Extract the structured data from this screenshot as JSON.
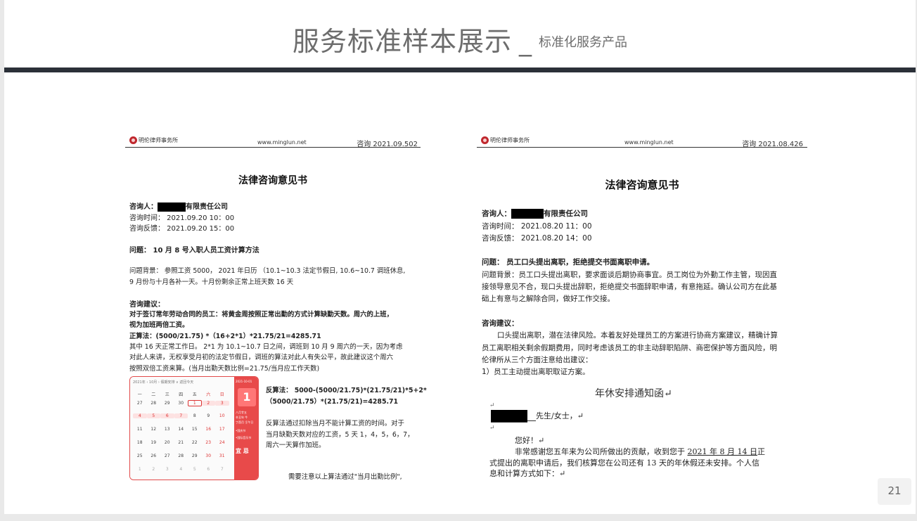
{
  "header": {
    "main_title": "服务标准样本展示",
    "separator": "_",
    "sub_title": "标准化服务产品"
  },
  "page_number": "21",
  "left_doc": {
    "logo_text": "明伦律师事务所",
    "url": "www.minglun.net",
    "doc_no": "咨询 2021.09.502",
    "title": "法律咨询意见书",
    "consultant_label": "咨询人：",
    "consultant_suffix": "有限责任公司",
    "time_line": "咨询时间： 2021.09.20 10：00",
    "feedback_line": "咨询反馈： 2021.09.20 15：00",
    "question": "问题： 10 月 8 号入职人员工资计算方法",
    "background_1": "问题背景： 参照工资 5000， 2021 年日历 （10.1~10.3 法定节假日, 10.6~10.7 调班休息,",
    "background_2": "9 月份与十月各补一天。十月份剩余正常上班天数 16 天",
    "advice_label": "咨询建议：",
    "advice_1": "对于签订常年劳动合同的员工：将黄金周按照正常出勤的方式计算缺勤天数。周六的上班，",
    "advice_2": "视为加班两倍工资。",
    "formula_1": "正算法：(5000/21.75) *（16+2*1）*21.75/21=4285.71",
    "explain_1": "其中 16 天正常工作日。 2*1 为 10.1~10.7 日之间，调班到 10 月 9 周六的一天，因为考虑",
    "explain_2": "对此人来讲，无权享受月初的法定节假日，调班的算法对此人有失公平，故此建议这个周六",
    "explain_3": "按照双倍工资来算。(当月出勤天数比例=21.75/当月应工作天数)",
    "reverse_1": "反算法： 5000-(5000/21.75)*(21.75/21)*5+2*",
    "reverse_2": "（5000/21.75）*(21.75/21)=4285.71",
    "reverse_desc_1": "反算法通过扣除当月不能计算工资的时间。对于",
    "reverse_desc_2": "当月缺勤天数对应的工资，5 天 1，4，5，6，7，",
    "reverse_desc_3": "周六一天算作加班。",
    "note": "需要注意以上算法通过\"当月出勤比例\","
  },
  "calendar": {
    "toolbar": "2021年  ‹  10月  ›  假期安排  ∨  返回今天",
    "weekdays": [
      "一",
      "二",
      "三",
      "四",
      "五",
      "六",
      "日"
    ],
    "rows": [
      [
        "27",
        "28",
        "29",
        "30",
        "1",
        "2",
        "3"
      ],
      [
        "4",
        "5",
        "6",
        "7",
        "8",
        "9",
        "10"
      ],
      [
        "11",
        "12",
        "13",
        "14",
        "15",
        "16",
        "17"
      ],
      [
        "18",
        "19",
        "20",
        "21",
        "22",
        "23",
        "24"
      ],
      [
        "25",
        "26",
        "27",
        "28",
        "29",
        "30",
        "31"
      ],
      [
        "1",
        "2",
        "3",
        "4",
        "5",
        "6",
        "7"
      ]
    ],
    "side_header": "2021-10-01",
    "big_day": "1",
    "side_lines": [
      "八月廿五",
      "辛丑年 牛",
      "丁酉月 壬午日",
      "•国庆节",
      "•国际音乐节"
    ],
    "side_bottom": "宜  忌"
  },
  "right_doc": {
    "logo_text": "明伦律师事务所",
    "url": "www.minglun.net",
    "doc_no": "咨询 2021.08.426",
    "title": "法律咨询意见书",
    "consultant_label": "咨询人：",
    "consultant_suffix": "有限责任公司",
    "time_line": "咨询时间： 2021.08.20 11：00",
    "feedback_line": "咨询反馈： 2021.08.20 14：00",
    "question": "问题： 员工口头提出离职，拒绝提交书面离职申请。",
    "background_1": "问题背景：员工口头提出离职，要求面谈后期协商事宜。员工岗位为外勤工作主管，现因直",
    "background_2": "接领导意见不合，现口头提出辞职，拒绝提交书面辞职申请，有意拖延。确认公司方在此基",
    "background_3": "础上有意与之解除合同，做好工作交接。",
    "advice_label": "咨询建议：",
    "advice_1": "口头提出离职，潜在法律风险。本着友好处理员工的方案进行协商方案建议，精确计算",
    "advice_2": "员工离职相关剩余假期费用，同时考虑该员工的非主动辞职陷阱、商密保护等方面风险，明",
    "advice_3": "伦律所从三个方面注意给出建议：",
    "advice_4": "1）员工主动提出离职取证方案。",
    "letter_title": "年休安排通知函↵",
    "mark_1": "↵",
    "salutation_suffix": "先生/女士，↵",
    "mark_2": "↵",
    "greeting": "您好！↵",
    "body_1a": "非常感谢您五年来为公司所做出的贡献，收到您于 ",
    "body_1b": "2021 年 8 月 14 日",
    "body_1c": "正",
    "body_2": "式提出的离职申请后，我们核算您在公司还有 13 天的年休假还未安排。个人信",
    "body_3": "息和计算方式如下：↵"
  }
}
